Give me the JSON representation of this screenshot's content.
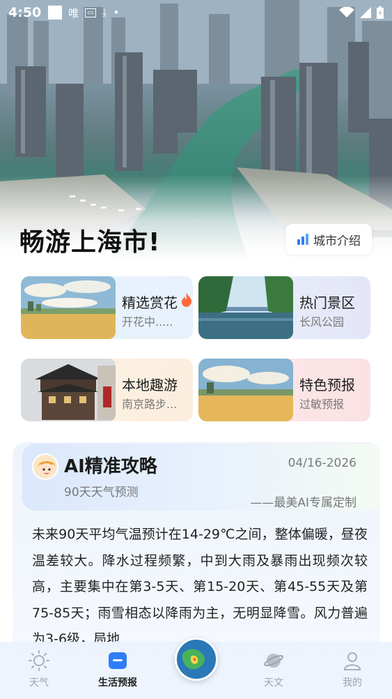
{
  "status_bar": {
    "time": "4:50",
    "carrier": "唯"
  },
  "hero": {
    "city_title": "畅游上海市!",
    "intro_button": "城市介绍"
  },
  "cards": [
    {
      "title": "精选赏花",
      "subtitle": "开花中.....",
      "badge_icon": "fire-icon"
    },
    {
      "title": "热门景区",
      "subtitle": "长风公园"
    },
    {
      "title": "本地趣游",
      "subtitle": "南京路步..."
    },
    {
      "title": "特色预报",
      "subtitle": "过敏预报"
    }
  ],
  "ai_card": {
    "title": "AI精准攻略",
    "date": "04/16-2026",
    "subtitle": "90天天气预测",
    "signature": "——最美AI专属定制",
    "body": "未来90天平均气温预计在14-29℃之间，整体偏暖，昼夜温差较大。降水过程频繁，中到大雨及暴雨出现频次较高，主要集中在第3-5天、第15-20天、第45-55天及第75-85天；雨雪相态以降雨为主，无明显降雪。风力普遍为3-6级，局地"
  },
  "bottom_nav": {
    "items": [
      {
        "label": "天气",
        "icon": "sun-icon"
      },
      {
        "label": "生活预报",
        "icon": "list-icon",
        "active": true
      },
      {
        "label": "",
        "icon": "radar-globe-icon"
      },
      {
        "label": "天文",
        "icon": "planet-icon"
      },
      {
        "label": "我的",
        "icon": "user-icon"
      }
    ]
  },
  "colors": {
    "accent_blue": "#2f7df6",
    "fire": "#ff6a3d"
  }
}
